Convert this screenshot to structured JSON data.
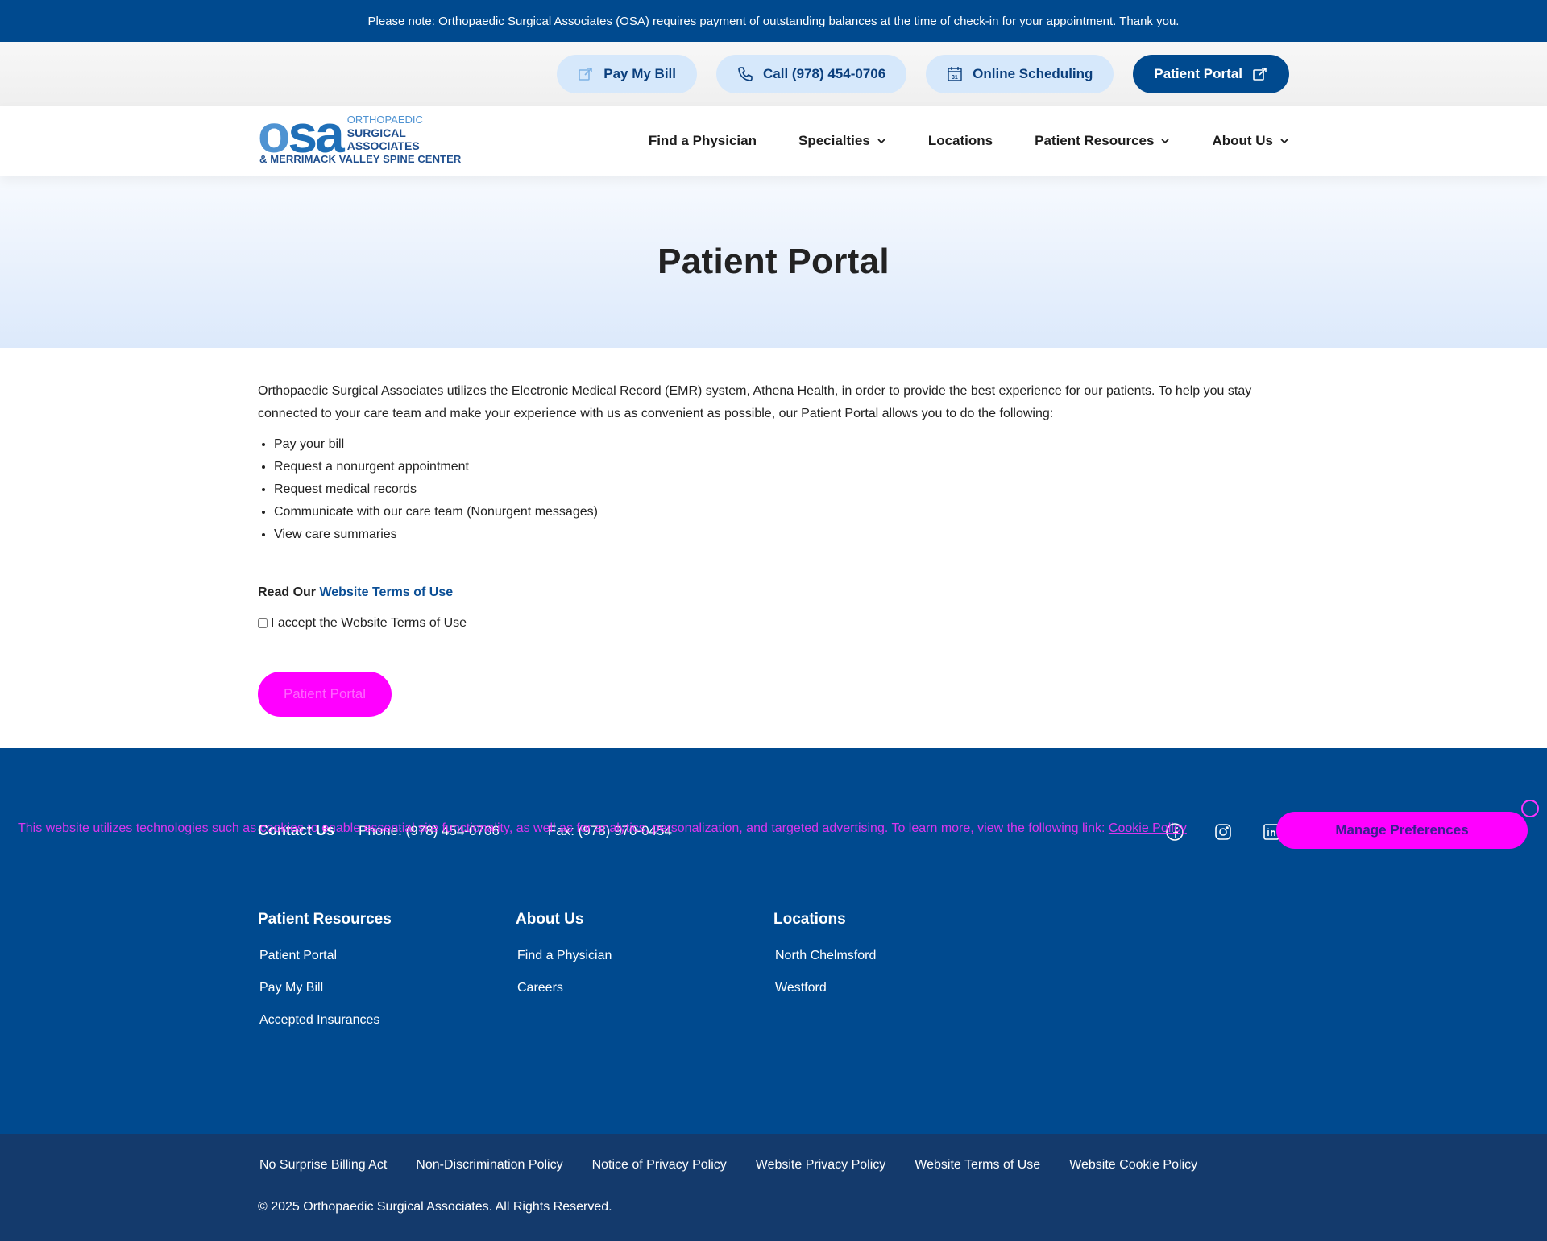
{
  "notice": "Please note: Orthopaedic Surgical Associates (OSA) requires payment of outstanding balances at the time of check-in for your appointment. Thank you.",
  "utility": {
    "pay_bill": "Pay My Bill",
    "call": "Call (978) 454-0706",
    "scheduling": "Online Scheduling",
    "portal": "Patient Portal"
  },
  "logo": {
    "mark": "osa",
    "line1": "ORTHOPAEDIC",
    "line2": "SURGICAL",
    "line3": "ASSOCIATES",
    "sub": "& MERRIMACK VALLEY SPINE CENTER"
  },
  "nav": {
    "find_physician": "Find a Physician",
    "specialties": "Specialties",
    "locations": "Locations",
    "patient_resources": "Patient Resources",
    "about_us": "About Us"
  },
  "hero": {
    "title": "Patient Portal"
  },
  "content": {
    "intro": "Orthopaedic Surgical Associates utilizes the Electronic Medical Record (EMR) system, Athena Health, in order to provide the best experience for our patients. To help you stay connected to your care team and make your experience with us as convenient as possible, our Patient Portal allows you to do the following:",
    "bullets": [
      "Pay your bill",
      "Request a nonurgent appointment",
      "Request medical records",
      "Communicate with our care team (Nonurgent messages)",
      "View care summaries"
    ],
    "terms_prefix": "Read Our",
    "terms_link": "Website Terms of Use",
    "accept_label": "I accept the Website Terms of Use",
    "launch_button": "Patient Portal"
  },
  "footer": {
    "contact_label": "Contact Us",
    "phone": "Phone: (978) 454-0706",
    "fax": "Fax: (978) 970-0454",
    "col1": {
      "title": "Patient Resources",
      "links": [
        "Patient Portal",
        "Pay My Bill",
        "Accepted Insurances"
      ]
    },
    "col2": {
      "title": "About Us",
      "links": [
        "Find a Physician",
        "Careers"
      ]
    },
    "col3": {
      "title": "Locations",
      "links": [
        "North Chelmsford",
        "Westford"
      ]
    },
    "social": [
      "facebook-icon",
      "instagram-icon",
      "linkedin-icon"
    ]
  },
  "bottom": {
    "legal": [
      "No Surprise Billing Act",
      "Non-Discrimination Policy",
      "Notice of Privacy Policy",
      "Website Privacy Policy",
      "Website Terms of Use",
      "Website Cookie Policy"
    ],
    "copyright": "© 2025 Orthopaedic Surgical Associates. All Rights Reserved."
  },
  "cookie": {
    "text": "This website utilizes technologies such as cookies to enable essential site functionality, as well as for analytics, personalization, and targeted advertising. To learn more, view the following link:",
    "link": "Cookie Policy",
    "button": "Manage Preferences"
  },
  "colors": {
    "primary": "#004a8f",
    "footer_bottom": "#143a6c",
    "accent_light": "#d6e8fb"
  }
}
